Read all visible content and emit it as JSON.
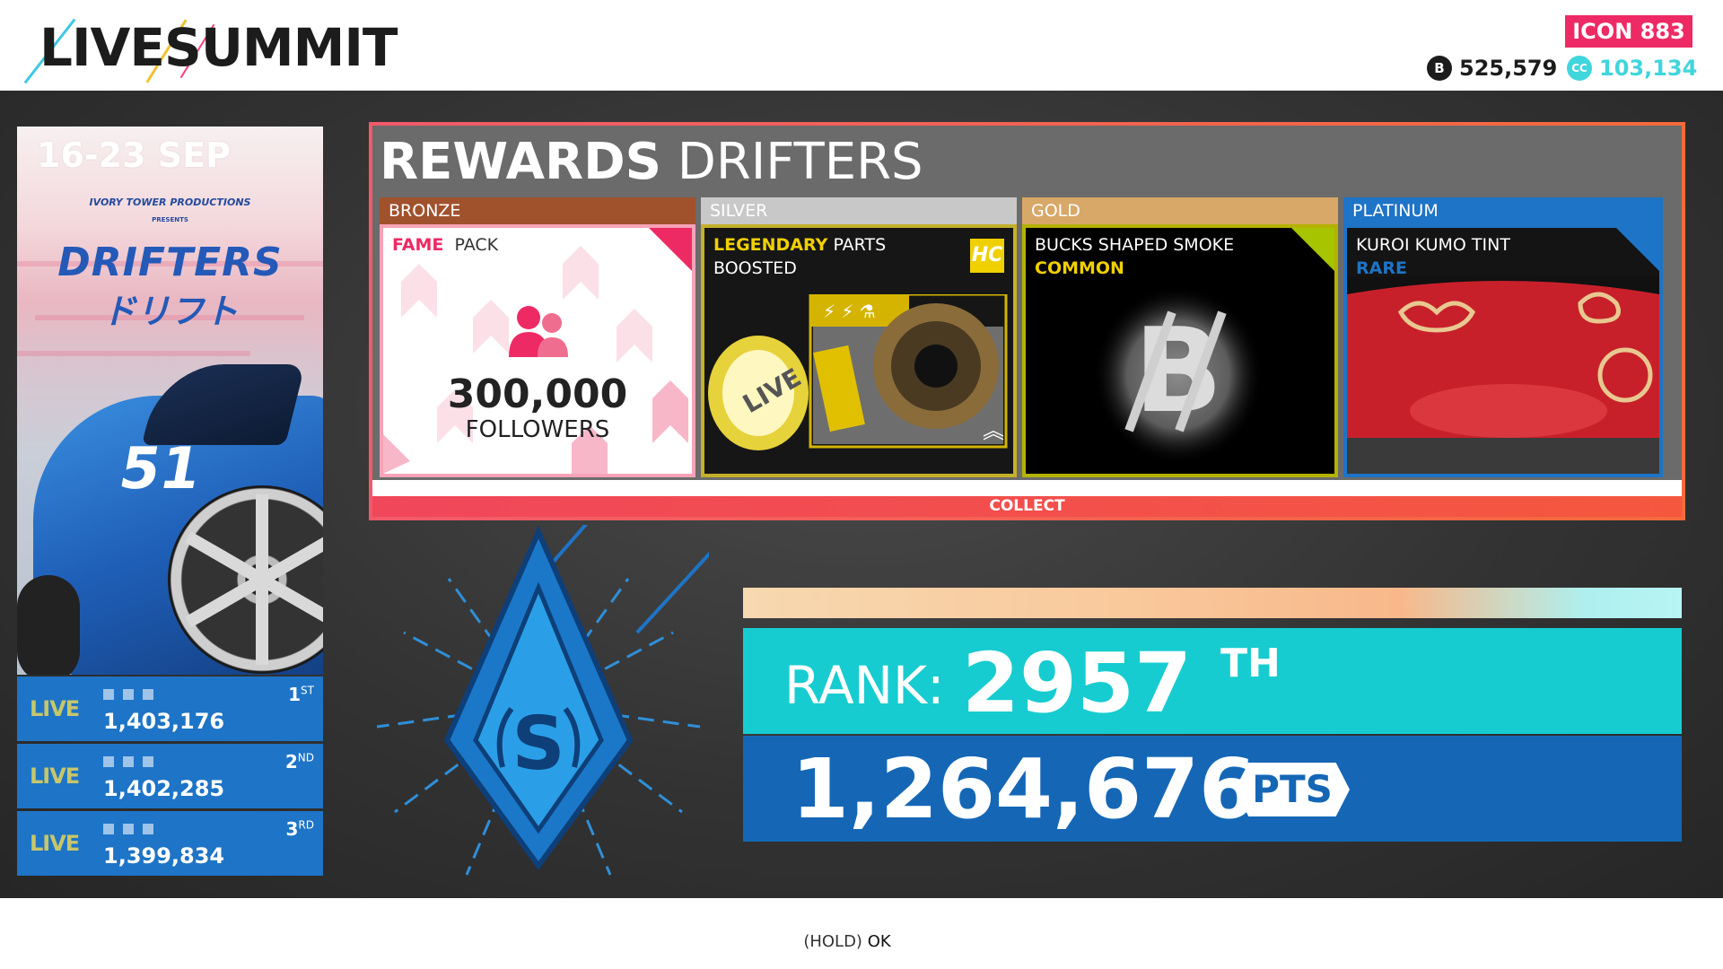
{
  "header": {
    "logo": "LIVESUMMIT",
    "icon_level": "ICON 883",
    "bucks": "525,579",
    "bucks_icon": "bucks-coin-icon",
    "cc": "103,134",
    "cc_icon_text": "CC"
  },
  "poster": {
    "date": "16-23 SEP",
    "producer": "IVORY TOWER PRODUCTIONS",
    "presents": "PRESENTS",
    "title": "DRIFTERS",
    "title_jp": "ドリフト",
    "car_number": "51"
  },
  "leaderboard": [
    {
      "logo": "LIVE",
      "points": "1,403,176",
      "place": "1",
      "suffix": "ST"
    },
    {
      "logo": "LIVE",
      "points": "1,402,285",
      "place": "2",
      "suffix": "ND"
    },
    {
      "logo": "LIVE",
      "points": "1,399,834",
      "place": "3",
      "suffix": "RD"
    }
  ],
  "rewards": {
    "title_bold": "REWARDS",
    "title_rest": "DRIFTERS",
    "tiers": [
      {
        "name": "BRONZE",
        "label_bold": "FAME",
        "label_rest": "PACK",
        "amount": "300,000",
        "unit": "FOLLOWERS",
        "color": "#a0522d"
      },
      {
        "name": "SILVER",
        "label_bold": "LEGENDARY",
        "label_rest": "PARTS",
        "line2": "BOOSTED",
        "badge": "HC",
        "color": "#c8c8c8"
      },
      {
        "name": "GOLD",
        "label_line1": "BUCKS SHAPED SMOKE",
        "rarity": "COMMON",
        "color": "#d8a868"
      },
      {
        "name": "PLATINUM",
        "label_line1": "KUROI KUMO TINT",
        "rarity": "RARE",
        "color": "#1e74c6"
      }
    ],
    "collect_label": "COLLECT"
  },
  "rank": {
    "label": "RANK:",
    "value": "2957",
    "suffix": "TH",
    "emblem_letter": "S",
    "points": "1,264,676",
    "points_tag": "PTS"
  },
  "footer": {
    "hold": "(HOLD)",
    "ok": "OK"
  },
  "colors": {
    "accent_pink": "#ee2a64",
    "teal": "#17ccd0",
    "blue": "#1567b6",
    "common_yellow": "#f0d000",
    "rare_blue": "#1e74c6"
  }
}
